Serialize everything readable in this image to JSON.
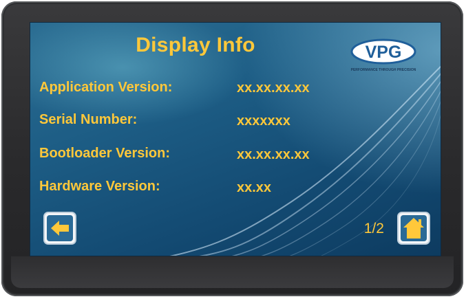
{
  "screen": {
    "title": "Display Info",
    "logo": {
      "text": "VPG",
      "tagline": "PERFORMANCE THROUGH PRECISION"
    },
    "rows": [
      {
        "label": "Application Version:",
        "value": "xx.xx.xx.xx"
      },
      {
        "label": "Serial Number:",
        "value": "xxxxxxx"
      },
      {
        "label": "Bootloader Version:",
        "value": "xx.xx.xx.xx"
      },
      {
        "label": "Hardware Version:",
        "value": "xx.xx"
      }
    ],
    "page_indicator": "1/2",
    "back_button_icon": "left-arrow-icon",
    "home_button_icon": "home-icon"
  },
  "colors": {
    "accent_text": "#ffc83a",
    "screen_background": "#1d5d85",
    "bezel": "#2e2e30"
  }
}
